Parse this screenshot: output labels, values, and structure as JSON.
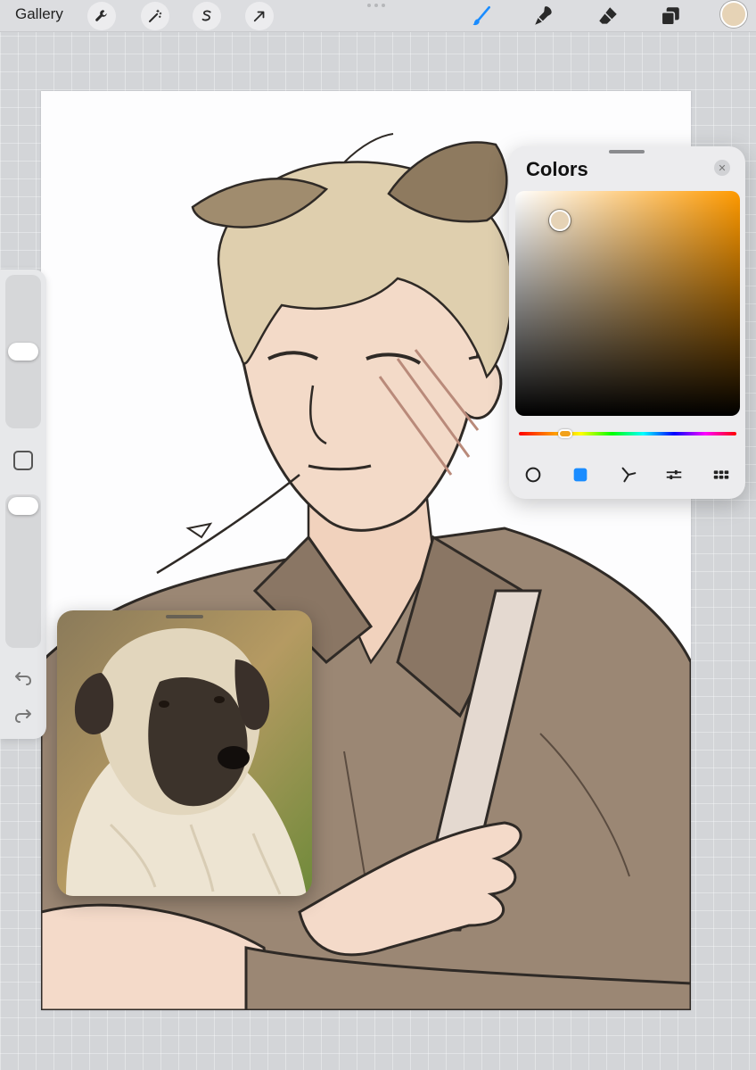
{
  "toolbar": {
    "gallery_label": "Gallery",
    "left_tools": [
      {
        "icon": "wrench-icon",
        "name": "actions"
      },
      {
        "icon": "magic-wand-icon",
        "name": "adjustments"
      },
      {
        "icon": "selection-icon",
        "name": "selection"
      },
      {
        "icon": "transform-arrow-icon",
        "name": "transform"
      }
    ],
    "right_tools": [
      {
        "icon": "brush-icon",
        "name": "paint",
        "active": true,
        "color": "#1a8cff"
      },
      {
        "icon": "smudge-icon",
        "name": "smudge"
      },
      {
        "icon": "eraser-icon",
        "name": "eraser"
      },
      {
        "icon": "layers-icon",
        "name": "layers"
      }
    ],
    "current_color": "#e6d3b6"
  },
  "sidebar": {
    "brush_size_level": 0.6,
    "opacity_level": 0.95,
    "modify_icon": "square-modify-icon",
    "undo_icon": "undo-arrow-icon",
    "redo_icon": "redo-arrow-icon"
  },
  "colors_panel": {
    "title": "Colors",
    "close_icon": "close-x-icon",
    "selected_color": "#e6d3b6",
    "hue_color": "#ff9a00",
    "hue_position": 0.12,
    "modes": [
      {
        "icon": "disc-mode-icon",
        "name": "disc",
        "active": false
      },
      {
        "icon": "classic-mode-icon",
        "name": "classic",
        "active": true
      },
      {
        "icon": "harmony-mode-icon",
        "name": "harmony",
        "active": false
      },
      {
        "icon": "value-sliders-icon",
        "name": "value",
        "active": false
      },
      {
        "icon": "palette-grid-icon",
        "name": "palettes",
        "active": false
      }
    ]
  },
  "reference": {
    "subject": "dog-reference-photo"
  }
}
